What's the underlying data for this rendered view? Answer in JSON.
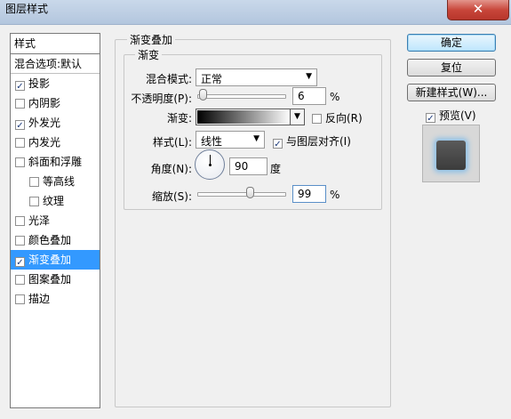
{
  "window": {
    "title": "图层样式",
    "close_glyph": "✕"
  },
  "sidebar": {
    "header": "样式",
    "blend_options": "混合选项:默认",
    "items": [
      {
        "label": "投影",
        "checked": true,
        "indent": false
      },
      {
        "label": "内阴影",
        "checked": false,
        "indent": false
      },
      {
        "label": "外发光",
        "checked": true,
        "indent": false
      },
      {
        "label": "内发光",
        "checked": false,
        "indent": false
      },
      {
        "label": "斜面和浮雕",
        "checked": false,
        "indent": false
      },
      {
        "label": "等高线",
        "checked": false,
        "indent": true
      },
      {
        "label": "纹理",
        "checked": false,
        "indent": true
      },
      {
        "label": "光泽",
        "checked": false,
        "indent": false
      },
      {
        "label": "颜色叠加",
        "checked": false,
        "indent": false
      },
      {
        "label": "渐变叠加",
        "checked": true,
        "indent": false,
        "selected": true
      },
      {
        "label": "图案叠加",
        "checked": false,
        "indent": false
      },
      {
        "label": "描边",
        "checked": false,
        "indent": false
      }
    ]
  },
  "panel": {
    "outer_title": "渐变叠加",
    "inner_title": "渐变",
    "blend_mode": {
      "label": "混合模式:",
      "value": "正常"
    },
    "opacity": {
      "label": "不透明度(P):",
      "value": "6",
      "unit": "%",
      "slider_fraction": 0.06
    },
    "gradient": {
      "label": "渐变:",
      "start_color": "#000000",
      "end_color": "#ffffff"
    },
    "reverse": {
      "label": "反向(R)",
      "checked": false
    },
    "style": {
      "label": "样式(L):",
      "value": "线性"
    },
    "align_with_layer": {
      "label": "与图层对齐(I)",
      "checked": true
    },
    "angle": {
      "label": "角度(N):",
      "value": "90",
      "unit": "度"
    },
    "scale": {
      "label": "缩放(S):",
      "value": "99",
      "unit": "%",
      "slider_fraction": 0.6
    }
  },
  "buttons": {
    "ok": "确定",
    "reset": "复位",
    "new_style": "新建样式(W)..."
  },
  "preview": {
    "label": "预览(V)",
    "checked": true
  },
  "colors": {
    "selection": "#3399ff",
    "glow": "#8fc1e6"
  },
  "check_glyph": "✓"
}
